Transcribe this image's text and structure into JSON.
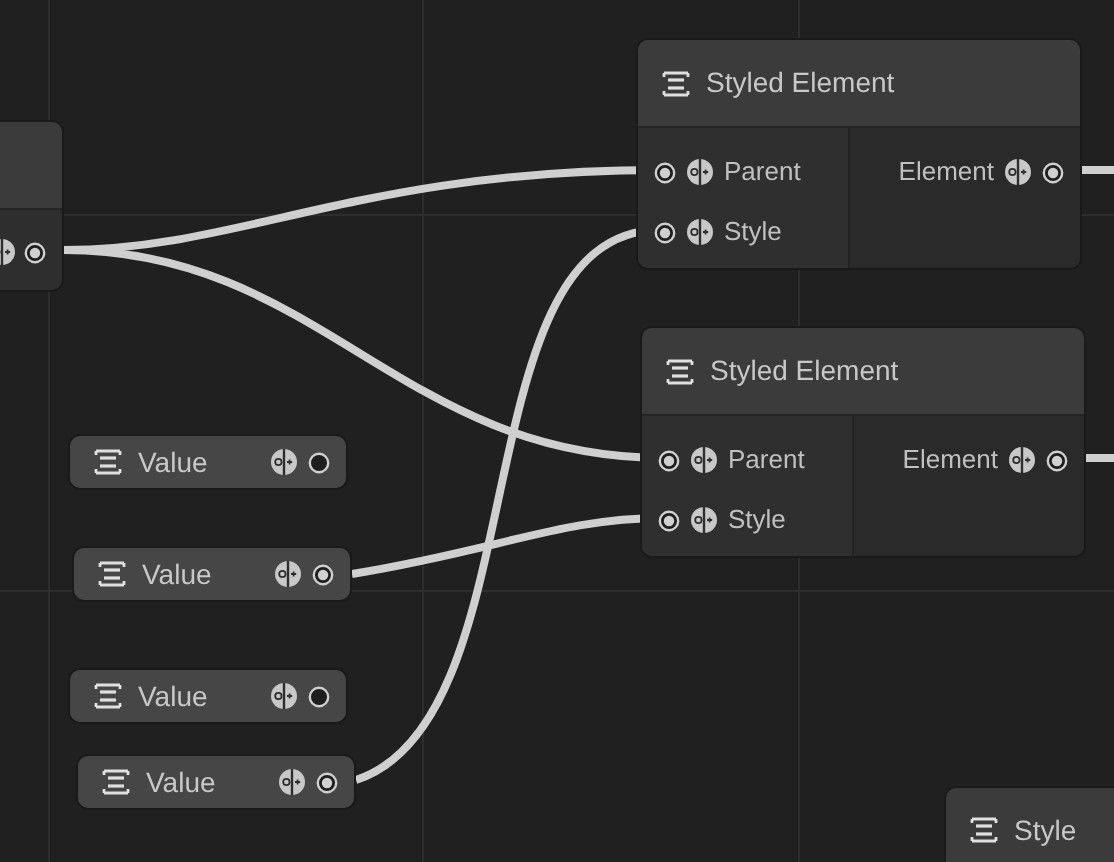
{
  "nodes": [
    {
      "kind": "partial",
      "outputs": [
        {
          "connected": true
        }
      ]
    },
    {
      "kind": "styled",
      "title": "Styled Element",
      "inputs": [
        {
          "label": "Parent",
          "connected": true
        },
        {
          "label": "Style",
          "connected": true
        }
      ],
      "outputs": [
        {
          "label": "Element",
          "connected": true
        }
      ]
    },
    {
      "kind": "styled",
      "title": "Styled Element",
      "inputs": [
        {
          "label": "Parent",
          "connected": true
        },
        {
          "label": "Style",
          "connected": true
        }
      ],
      "outputs": [
        {
          "label": "Element",
          "connected": true
        }
      ]
    },
    {
      "kind": "value",
      "title": "Value",
      "connected": false
    },
    {
      "kind": "value",
      "title": "Value",
      "connected": true
    },
    {
      "kind": "value",
      "title": "Value",
      "connected": false
    },
    {
      "kind": "value",
      "title": "Value",
      "connected": true
    },
    {
      "kind": "header",
      "title": "Style"
    }
  ]
}
